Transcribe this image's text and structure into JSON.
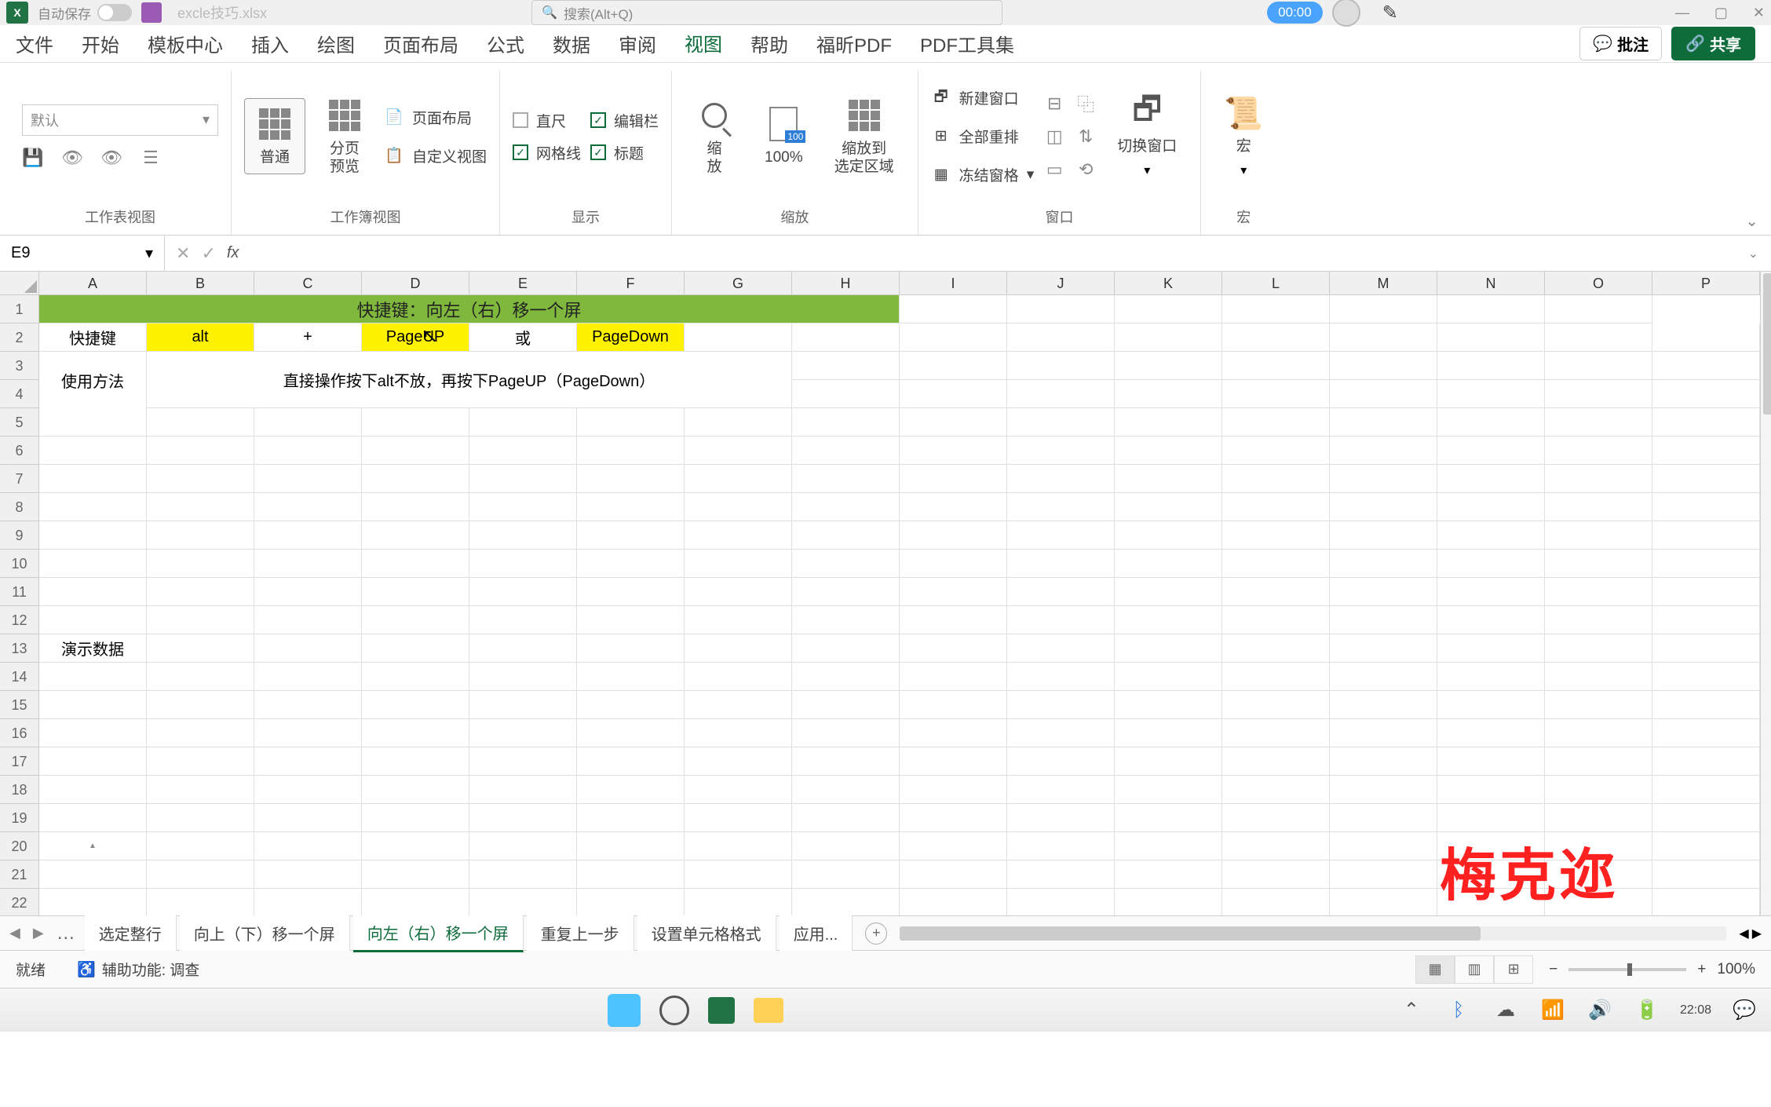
{
  "title_bar": {
    "autosave_label": "自动保存",
    "filename": "excle技巧.xlsx",
    "search_placeholder": "搜索(Alt+Q)",
    "timer": "00:00"
  },
  "tabs": {
    "file": "文件",
    "home": "开始",
    "template": "模板中心",
    "insert": "插入",
    "draw": "绘图",
    "layout": "页面布局",
    "formula": "公式",
    "data": "数据",
    "review": "审阅",
    "view": "视图",
    "help": "帮助",
    "foxit": "福昕PDF",
    "pdftools": "PDF工具集",
    "comment_btn": "批注",
    "share_btn": "共享"
  },
  "ribbon": {
    "default_dropdown": "默认",
    "normal": "普通",
    "page_break": "分页\n预览",
    "page_layout": "页面布局",
    "custom_view": "自定义视图",
    "ruler": "直尺",
    "formula_bar": "编辑栏",
    "gridlines": "网格线",
    "headings": "标题",
    "zoom": "缩\n放",
    "zoom100": "100%",
    "zoom_select": "缩放到\n选定区域",
    "new_window": "新建窗口",
    "arrange_all": "全部重排",
    "freeze": "冻结窗格",
    "switch_window": "切换窗口",
    "macros": "宏",
    "g1": "工作表视图",
    "g2": "工作簿视图",
    "g3": "显示",
    "g4": "缩放",
    "g5": "窗口",
    "g6": "宏"
  },
  "name_box": "E9",
  "grid": {
    "row1": "快捷键：向左（右）移一个屏",
    "r2a": "快捷键",
    "r2b": "alt",
    "r2c": "+",
    "r2d": "PageUP",
    "r2e": "或",
    "r2f": "PageDown",
    "r34a": "使用方法",
    "r34b": "直接操作按下alt不放，再按下PageUP（PageDown）",
    "r13a": "演示数据"
  },
  "watermark": "梅克迩",
  "sheet_tabs": {
    "t1": "选定整行",
    "t2": "向上（下）移一个屏",
    "t3": "向左（右）移一个屏",
    "t4": "重复上一步",
    "t5": "设置单元格格式",
    "t6": "应用..."
  },
  "status": {
    "ready": "就绪",
    "accessibility": "辅助功能: 调查",
    "zoom_pct": "100%"
  },
  "taskbar": {
    "time": "22:08"
  },
  "cols": [
    "A",
    "B",
    "C",
    "D",
    "E",
    "F",
    "G",
    "H",
    "I",
    "J",
    "K",
    "L",
    "M",
    "N",
    "O",
    "P"
  ]
}
